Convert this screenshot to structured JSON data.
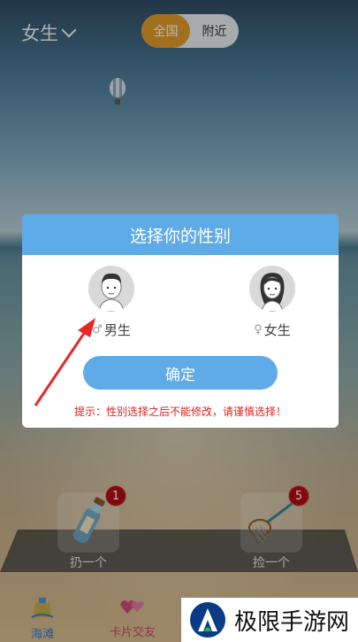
{
  "top_bar": {
    "gender_filter": "女生",
    "scope_tabs": [
      {
        "label": "全国",
        "active": true
      },
      {
        "label": "附近",
        "active": false
      }
    ]
  },
  "modal": {
    "title": "选择你的性别",
    "options": [
      {
        "label": "男生",
        "symbol": "♂"
      },
      {
        "label": "女生",
        "symbol": "♀"
      }
    ],
    "confirm_label": "确定",
    "hint": "提示：性别选择之后不能修改，请谨慎选择！"
  },
  "actions": {
    "throw": {
      "label": "扔一个",
      "badge": "1"
    },
    "pick": {
      "label": "捡一个",
      "badge": "5"
    }
  },
  "bottom_nav": [
    {
      "label": "海滩"
    },
    {
      "label": "卡片交友"
    }
  ],
  "watermark": {
    "text": "极限手游网"
  },
  "colors": {
    "accent_blue": "#5eabe8",
    "active_tab": "#e09a2a",
    "badge_red": "#b30d12",
    "hint_red": "#dd2222"
  }
}
